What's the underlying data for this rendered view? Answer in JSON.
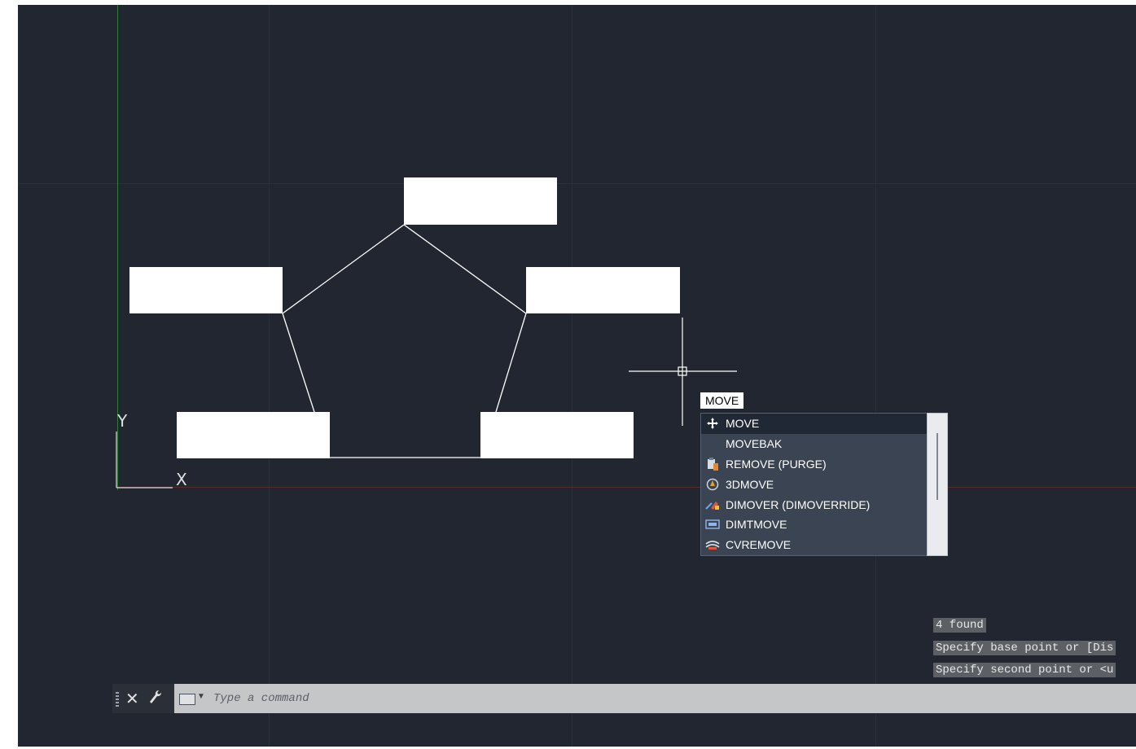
{
  "tooltip": {
    "label": "MOVE"
  },
  "suggestions": [
    {
      "label": "MOVE",
      "icon": "move-arrows-icon",
      "selected": true
    },
    {
      "label": "MOVEBAK",
      "icon": "",
      "selected": false
    },
    {
      "label": "REMOVE (PURGE)",
      "icon": "purge-icon",
      "selected": false
    },
    {
      "label": "3DMOVE",
      "icon": "3dmove-icon",
      "selected": false
    },
    {
      "label": "DIMOVER (DIMOVERRIDE)",
      "icon": "dimoverride-icon",
      "selected": false
    },
    {
      "label": "DIMTMOVE",
      "icon": "dimtmove-icon",
      "selected": false
    },
    {
      "label": "CVREMOVE",
      "icon": "cvremove-icon",
      "selected": false
    }
  ],
  "history": {
    "line1": "4 found",
    "line2": "Specify base point or [Dis",
    "line3": "Specify second point or <u"
  },
  "command_line": {
    "placeholder": "Type a command"
  },
  "ucs": {
    "x_label": "X",
    "y_label": "Y"
  },
  "colors": {
    "canvas": "#212630",
    "y_axis": "#2f7a38",
    "x_axis": "#5a2a2a",
    "drawing": "#ffffff"
  }
}
